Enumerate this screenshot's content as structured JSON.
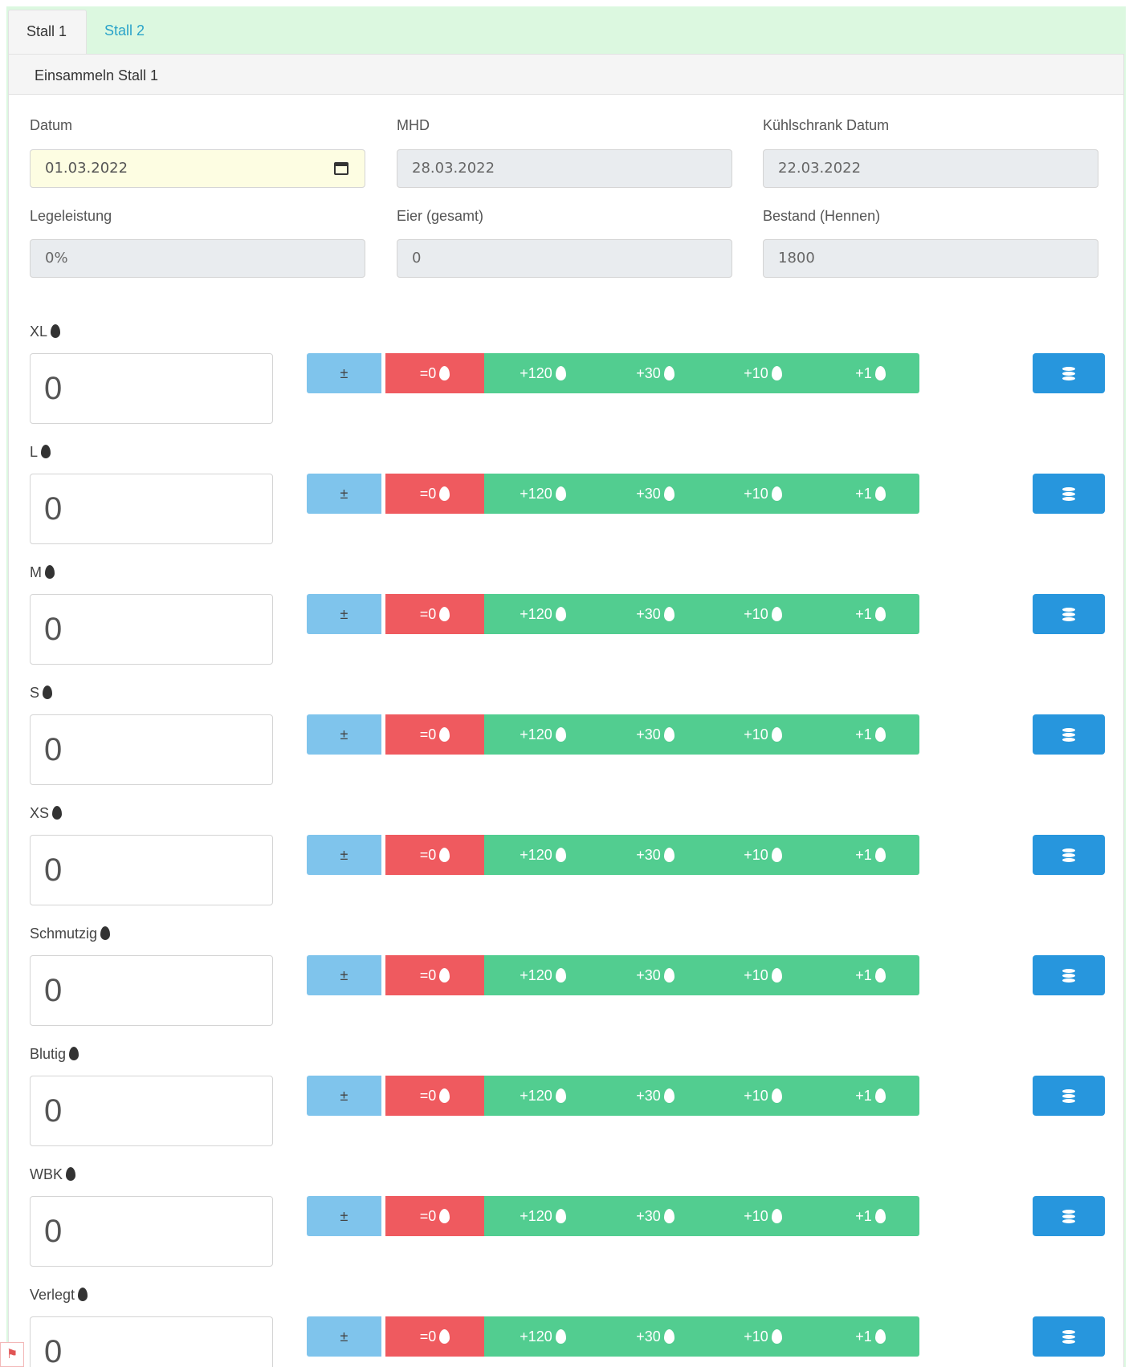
{
  "tabs": [
    {
      "label": "Stall 1",
      "active": true
    },
    {
      "label": "Stall 2",
      "active": false
    }
  ],
  "panel": {
    "title": "Einsammeln Stall 1"
  },
  "fields": {
    "datum": {
      "label": "Datum",
      "value": "01.03.2022"
    },
    "mhd": {
      "label": "MHD",
      "value": "28.03.2022"
    },
    "kuehlschrank": {
      "label": "Kühlschrank Datum",
      "value": "22.03.2022"
    },
    "legeleistung": {
      "label": "Legeleistung",
      "value": "0%"
    },
    "eier": {
      "label": "Eier (gesamt)",
      "value": "0"
    },
    "bestand": {
      "label": "Bestand (Hennen)",
      "value": "1800"
    }
  },
  "buttons": {
    "toggle_sign": "±",
    "reset": "=0",
    "add120": "+120",
    "add30": "+30",
    "add10": "+10",
    "add1": "+1"
  },
  "categories": [
    {
      "label": "XL",
      "value": "0"
    },
    {
      "label": "L",
      "value": "0"
    },
    {
      "label": "M",
      "value": "0"
    },
    {
      "label": "S",
      "value": "0"
    },
    {
      "label": "XS",
      "value": "0"
    },
    {
      "label": "Schmutzig",
      "value": "0"
    },
    {
      "label": "Blutig",
      "value": "0"
    },
    {
      "label": "WBK",
      "value": "0"
    },
    {
      "label": "Verlegt",
      "value": "0"
    }
  ],
  "icons": {
    "egg": "egg-icon",
    "save": "database-icon",
    "calendar": "calendar-icon"
  },
  "colors": {
    "accent": "#29a3c9",
    "green": "#52cd90",
    "red": "#ef5a5f",
    "blue": "#2796dd",
    "light_blue": "#7fc4ec",
    "page_bg": "#dcf8e0"
  }
}
